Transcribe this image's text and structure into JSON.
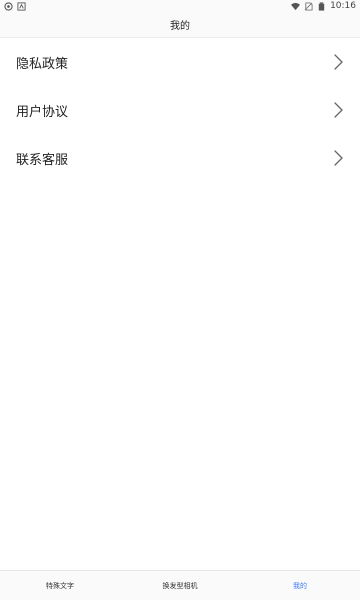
{
  "status_bar": {
    "time": "10:16",
    "left_icons": [
      "app-notification-icon",
      "a-notification-icon"
    ],
    "right_icons": [
      "wifi-icon",
      "no-sim-icon",
      "battery-icon"
    ]
  },
  "header": {
    "title": "我的"
  },
  "menu": {
    "items": [
      {
        "label": "隐私政策",
        "icon": "chevron-right-icon"
      },
      {
        "label": "用户协议",
        "icon": "chevron-right-icon"
      },
      {
        "label": "联系客服",
        "icon": "chevron-right-icon"
      }
    ]
  },
  "bottom_nav": {
    "tabs": [
      {
        "label": "特殊文字"
      },
      {
        "label": "换发型相机"
      },
      {
        "label": "我的"
      }
    ],
    "active_index": 2,
    "active_color": "#3b7bf5"
  }
}
